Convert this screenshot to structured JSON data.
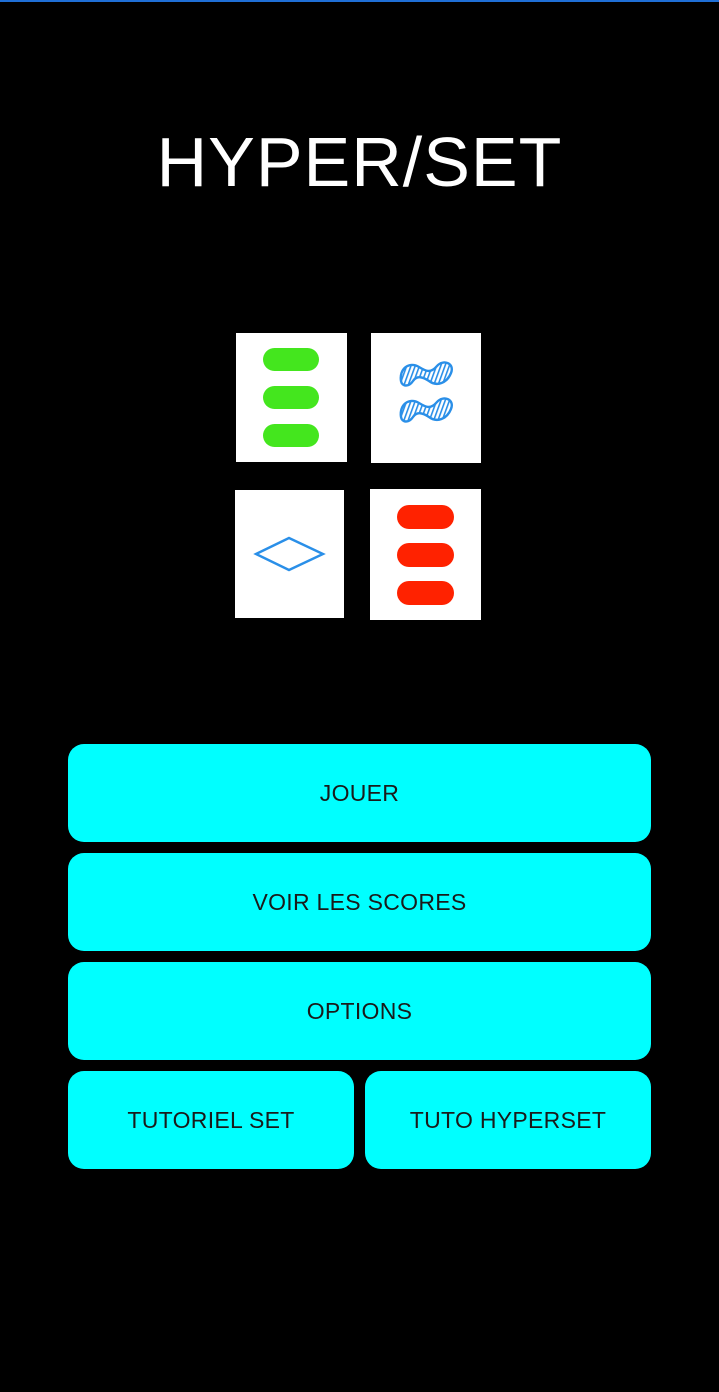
{
  "app": {
    "title": "HYPER/SET"
  },
  "cards": [
    {
      "name": "card-green-ovals",
      "shape": "oval",
      "count": 3,
      "color": "#44e61e",
      "fill": "solid"
    },
    {
      "name": "card-blue-squiggles",
      "shape": "squiggle",
      "count": 2,
      "color": "#2a8fe8",
      "fill": "striped"
    },
    {
      "name": "card-blue-diamond",
      "shape": "diamond",
      "count": 1,
      "color": "#2a8fe8",
      "fill": "empty"
    },
    {
      "name": "card-red-ovals",
      "shape": "oval",
      "count": 3,
      "color": "#ff2200",
      "fill": "solid"
    }
  ],
  "menu": {
    "play_label": "JOUER",
    "scores_label": "VOIR LES SCORES",
    "options_label": "OPTIONS",
    "tutorial_set_label": "TUTORIEL SET",
    "tutorial_hyperset_label": "TUTO HYPERSET"
  },
  "colors": {
    "background": "#000000",
    "button": "#00ffff",
    "button_text": "#1a1a1a",
    "title": "#ffffff"
  }
}
